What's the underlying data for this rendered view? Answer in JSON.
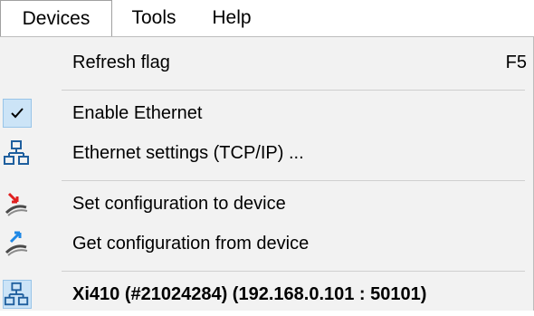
{
  "menubar": {
    "items": [
      {
        "label": "Devices",
        "active": true
      },
      {
        "label": "Tools",
        "active": false
      },
      {
        "label": "Help",
        "active": false
      }
    ]
  },
  "devices_menu": {
    "items": [
      {
        "label": "Refresh flag",
        "shortcut": "F5",
        "icon": "none"
      },
      {
        "label": "Enable Ethernet",
        "icon": "checkmark-icon",
        "checked": true
      },
      {
        "label": "Ethernet settings (TCP/IP) ...",
        "icon": "network-icon"
      },
      {
        "label": "Set configuration to device",
        "icon": "upload-config-icon"
      },
      {
        "label": "Get configuration from device",
        "icon": "download-config-icon"
      },
      {
        "label": "Xi410  (#21024284)  (192.168.0.101 : 50101)",
        "icon": "network-icon",
        "selected": true
      }
    ]
  },
  "colors": {
    "menu_background": "#f2f2f2",
    "check_highlight": "#cce4f7",
    "network_icon": "#1f5f9e",
    "arrow_red": "#e02020",
    "arrow_blue": "#1e88e5"
  }
}
